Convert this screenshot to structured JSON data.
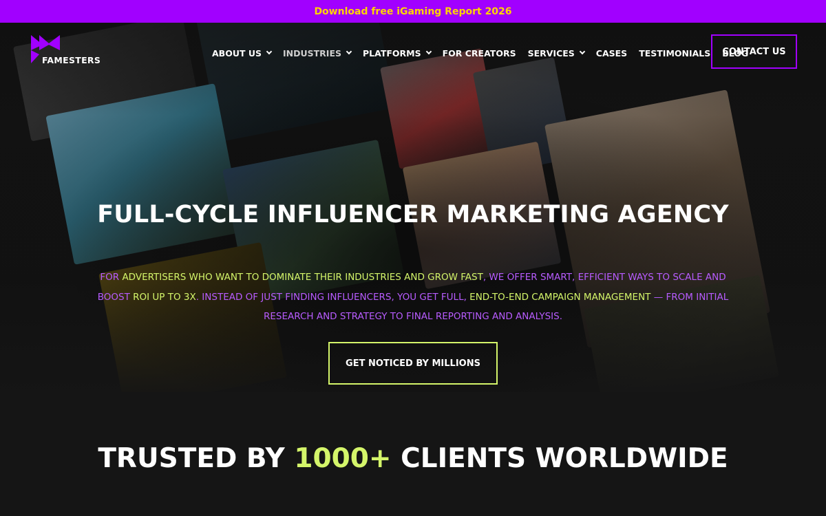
{
  "promo": {
    "text": "Download free iGaming Report 2026"
  },
  "brand": {
    "name": "FAMESTERS",
    "accent": "#a100ff",
    "highlight": "#d4f56a",
    "promo_text_color": "#ffd400"
  },
  "nav": {
    "items": [
      {
        "label": "ABOUT US",
        "dropdown": true
      },
      {
        "label": "INDUSTRIES",
        "dropdown": true
      },
      {
        "label": "PLATFORMS",
        "dropdown": true
      },
      {
        "label": "FOR CREATORS",
        "dropdown": false
      },
      {
        "label": "SERVICES",
        "dropdown": true
      },
      {
        "label": "CASES",
        "dropdown": false
      },
      {
        "label": "TESTIMONIALS",
        "dropdown": false
      },
      {
        "label": "BLOG",
        "dropdown": false
      }
    ],
    "contact_label": "CONTACT US"
  },
  "hero": {
    "title": "FULL-CYCLE INFLUENCER MARKETING AGENCY",
    "desc": {
      "s1": "FOR ",
      "s2": "ADVERTISERS WHO WANT TO DOMINATE THEIR INDUSTRIES AND GROW FAST",
      "s3": ", WE OFFER SMART, EFFICIENT WAYS TO SCALE AND BOOST ",
      "s4": "ROI UP TO 3X",
      "s5": ". INSTEAD OF JUST FINDING INFLUENCERS, YOU GET FULL, ",
      "s6": "END-TO-END CAMPAIGN MANAGEMENT",
      "s7": " — FROM INITIAL RESEARCH AND STRATEGY TO FINAL REPORTING AND ANALYSIS."
    },
    "cta_label": "GET NOTICED BY MILLIONS"
  },
  "trusted": {
    "prefix": "TRUSTED BY ",
    "highlight": "1000+",
    "suffix": " CLIENTS WORLDWIDE"
  }
}
